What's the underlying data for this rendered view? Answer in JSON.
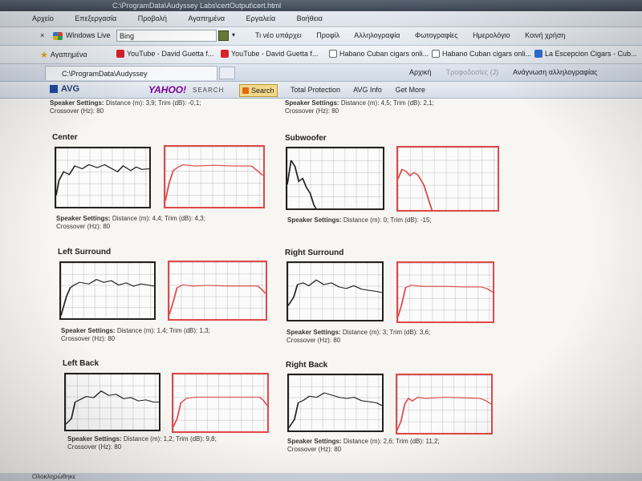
{
  "window": {
    "title_path": "C:\\ProgramData\\Audyssey Labs\\certOutput\\cert.html"
  },
  "menu": [
    "Αρχείο",
    "Επεξεργασία",
    "Προβολή",
    "Αγαπημένα",
    "Εργαλεία",
    "Βοήθεια"
  ],
  "live_toolbar": {
    "close": "×",
    "brand": "Windows Live",
    "search_value": "Bing",
    "links": [
      "Τι νέο υπάρχει",
      "Προφίλ",
      "Αλληλογραφία",
      "Φωτογραφίες",
      "Ημερολόγιο",
      "Κοινή χρήση"
    ]
  },
  "favorites_bar": {
    "favorites_label": "Αγαπημένα",
    "items": [
      "YouTube - David Guetta f...",
      "YouTube - David Guetta f...",
      "Habano Cuban cigars onli...",
      "Habano Cuban cigars onli...",
      "La Escepcion Cigars - Cub..."
    ]
  },
  "tab_bar": {
    "tab_title": "C:\\ProgramData\\Audyssey Labs\\certOutput\\cert...",
    "home": "Αρχική",
    "feeds": "Τροφοδοσίες (J)",
    "read_mail": "Ανάγνωση αλληλογραφίας"
  },
  "avg_toolbar": {
    "brand": "AVG",
    "yahoo": "YAHOO!",
    "yahoo_search": "SEARCH",
    "search_button": "Search",
    "total_protection": "Total Protection",
    "avg_info": "AVG Info",
    "get_more": "Get More"
  },
  "page": {
    "speaker_settings_label": "Speaker Settings:",
    "top_left_settings": "Distance (m): 3,9; Trim (dB): -0,1;",
    "top_left_crossover": "Crossover (Hz): 80",
    "top_right_settings": "Distance (m): 4,5; Trim (dB): 2,1;",
    "top_right_crossover": "Crossover (Hz): 80",
    "speakers": [
      {
        "name": "Center",
        "settings": "Distance (m): 4,4; Trim (dB): 4,3;",
        "crossover": "Crossover (Hz): 80"
      },
      {
        "name": "Subwoofer",
        "settings": "Distance (m): 0; Trim (dB): -15;",
        "crossover": ""
      },
      {
        "name": "Left Surround",
        "settings": "Distance (m): 1,4; Trim (dB): 1,3;",
        "crossover": "Crossover (Hz): 80"
      },
      {
        "name": "Right Surround",
        "settings": "Distance (m): 3; Trim (dB): 3,6;",
        "crossover": "Crossover (Hz): 80"
      },
      {
        "name": "Left Back",
        "settings": "Distance (m): 1,2; Trim (dB): 9,8;",
        "crossover": "Crossover (Hz): 80"
      },
      {
        "name": "Right Back",
        "settings": "Distance (m): 2,6; Trim (dB): 11,2;",
        "crossover": "Crossover (Hz): 80"
      }
    ]
  },
  "status_bar": {
    "text": "Ολοκληρώθηκε"
  },
  "colors": {
    "before_curve": "#222222",
    "after_curve": "#e04848"
  }
}
